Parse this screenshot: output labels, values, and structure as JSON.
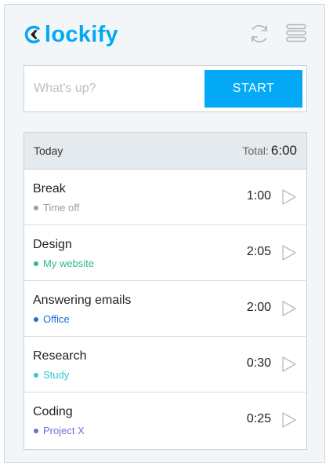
{
  "app": {
    "brand": "lockify",
    "accent": "#03a9f4"
  },
  "header": {
    "sync_icon": "sync-icon",
    "menu_icon": "hamburger-menu-icon"
  },
  "timer": {
    "placeholder": "What's up?",
    "start_label": "START"
  },
  "day": {
    "label": "Today",
    "total_label": "Total:",
    "total_value": "6:00"
  },
  "entries": [
    {
      "description": "Break",
      "project": "Time off",
      "project_color": "#9e9e9e",
      "duration": "1:00"
    },
    {
      "description": "Design",
      "project": "My website",
      "project_color": "#2bba8a",
      "duration": "2:05"
    },
    {
      "description": "Answering emails",
      "project": "Office",
      "project_color": "#1e6fd9",
      "duration": "2:00"
    },
    {
      "description": "Research",
      "project": "Study",
      "project_color": "#2ec7cf",
      "duration": "0:30"
    },
    {
      "description": "Coding",
      "project": "Project X",
      "project_color": "#6b6fd6",
      "duration": "0:25"
    }
  ]
}
